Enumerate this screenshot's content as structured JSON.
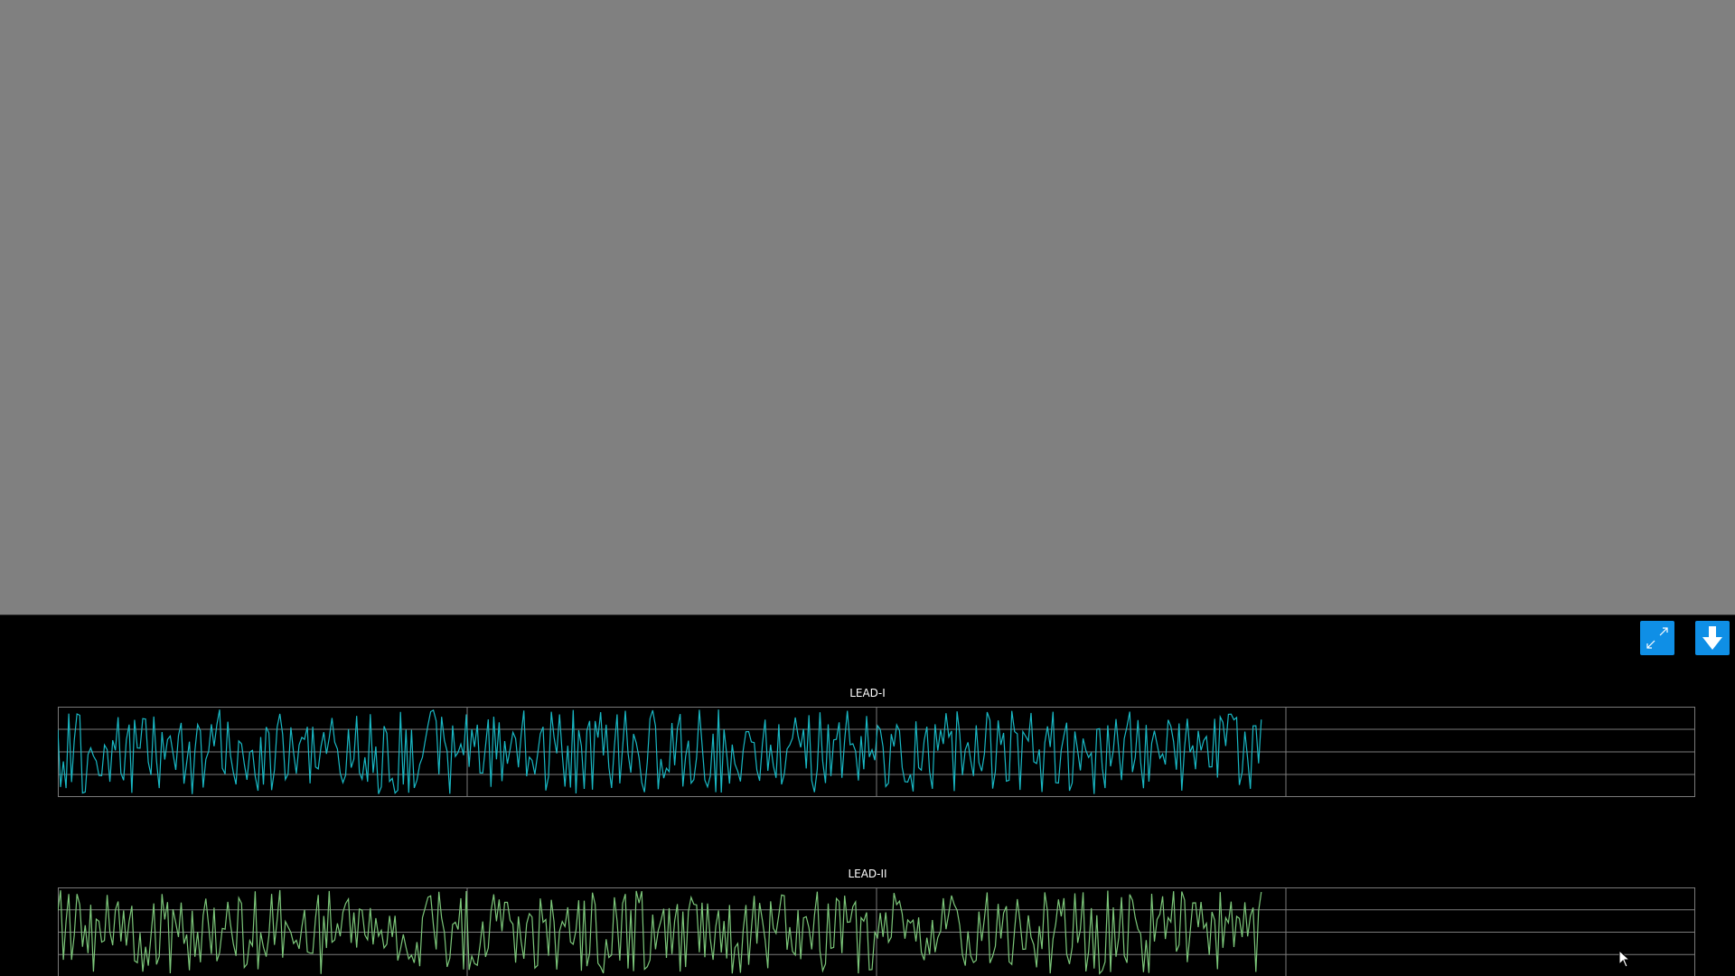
{
  "toolbar": {
    "expand_icon": "expand-arrows-icon",
    "download_icon": "download-arrow-icon",
    "button_color": "#0f8fe6"
  },
  "leads": [
    {
      "label": "LEAD-I",
      "color": "#19b8c4",
      "seed": 7,
      "samples": 440,
      "fill_fraction": 0.735
    },
    {
      "label": "LEAD-II",
      "color": "#7cc77a",
      "seed": 19,
      "samples": 440,
      "fill_fraction": 0.735
    }
  ],
  "grid": {
    "line_color": "#7a7a7a",
    "columns": 4,
    "rows": 4
  },
  "colors": {
    "background_top": "#808080",
    "panel_background": "#000000"
  }
}
